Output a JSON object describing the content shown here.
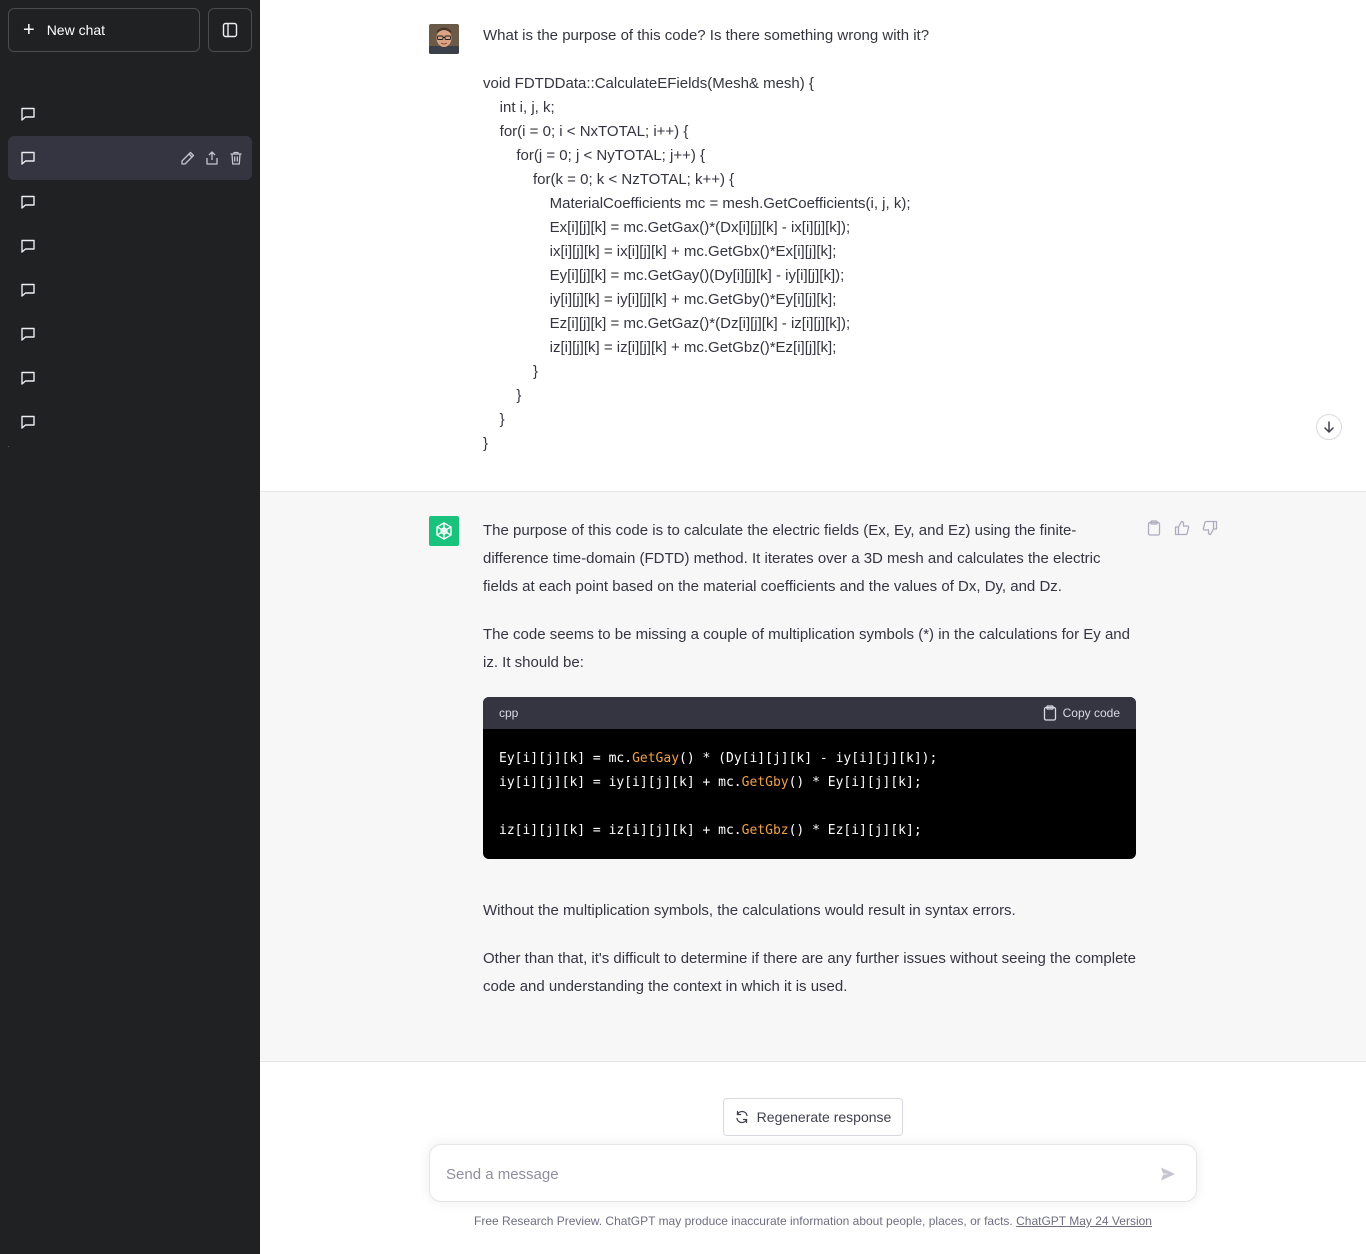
{
  "sidebar": {
    "new_chat_label": "New chat",
    "chats": [
      {
        "label": "",
        "active": false
      },
      {
        "label": "",
        "active": true
      },
      {
        "label": "",
        "active": false
      },
      {
        "label": "",
        "active": false
      },
      {
        "label": "",
        "active": false
      },
      {
        "label": "",
        "active": false
      },
      {
        "label": "",
        "active": false
      },
      {
        "label": "",
        "active": false
      }
    ]
  },
  "conversation": {
    "user_message": {
      "question": "What is the purpose of this code? Is there something wrong with it?",
      "code_lines": [
        "void FDTDData::CalculateEFields(Mesh& mesh) {",
        "    int i, j, k;",
        "    for(i = 0; i < NxTOTAL; i++) {",
        "        for(j = 0; j < NyTOTAL; j++) {",
        "            for(k = 0; k < NzTOTAL; k++) {",
        "                MaterialCoefficients mc = mesh.GetCoefficients(i, j, k);",
        "                Ex[i][j][k] = mc.GetGax()*(Dx[i][j][k] - ix[i][j][k]);",
        "                ix[i][j][k] = ix[i][j][k] + mc.GetGbx()*Ex[i][j][k];",
        "                Ey[i][j][k] = mc.GetGay()(Dy[i][j][k] - iy[i][j][k]);",
        "                iy[i][j][k] = iy[i][j][k] + mc.GetGby()*Ey[i][j][k];",
        "                Ez[i][j][k] = mc.GetGaz()*(Dz[i][j][k] - iz[i][j][k]);",
        "                iz[i][j][k] = iz[i][j][k] + mc.GetGbz()*Ez[i][j][k];",
        "            }",
        "        }",
        "    }",
        "}"
      ]
    },
    "assistant_message": {
      "paragraph_1": "The purpose of this code is to calculate the electric fields (Ex, Ey, and Ez) using the finite-difference time-domain (FDTD) method. It iterates over a 3D mesh and calculates the electric fields at each point based on the material coefficients and the values of Dx, Dy, and Dz.",
      "paragraph_2": "The code seems to be missing a couple of multiplication symbols (*) in the calculations for Ey and iz. It should be:",
      "code_block": {
        "language": "cpp",
        "copy_label": "Copy code",
        "lines": [
          {
            "pre": "Ey[i][j][k] = mc.",
            "fn": "GetGay",
            "post": "() * (Dy[i][j][k] - iy[i][j][k]);"
          },
          {
            "pre": "iy[i][j][k] = iy[i][j][k] + mc.",
            "fn": "GetGby",
            "post": "() * Ey[i][j][k];"
          },
          {
            "pre": "",
            "fn": "",
            "post": ""
          },
          {
            "pre": "iz[i][j][k] = iz[i][j][k] + mc.",
            "fn": "GetGbz",
            "post": "() * Ez[i][j][k];"
          }
        ]
      },
      "paragraph_3": "Without the multiplication symbols, the calculations would result in syntax errors.",
      "paragraph_4": "Other than that, it's difficult to determine if there are any further issues without seeing the complete code and understanding the context in which it is used."
    }
  },
  "composer": {
    "regenerate_label": "Regenerate response",
    "placeholder": "Send a message",
    "footer_text": "Free Research Preview. ChatGPT may produce inaccurate information about people, places, or facts. ",
    "footer_link": "ChatGPT May 24 Version"
  },
  "colors": {
    "sidebar_bg": "#202123",
    "active_chat_bg": "#343541",
    "assistant_bg": "#f7f7f8",
    "gpt_logo": "#19c37d",
    "code_fn": "#f0a04b"
  }
}
